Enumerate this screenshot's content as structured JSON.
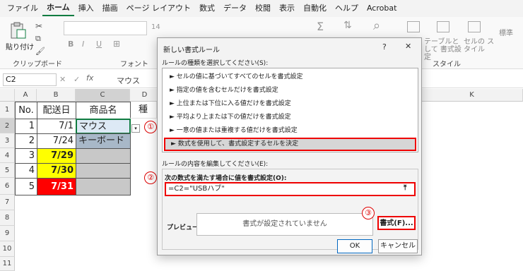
{
  "menu": [
    "ファイル",
    "ホーム",
    "挿入",
    "描画",
    "ページ レイアウト",
    "数式",
    "データ",
    "校閲",
    "表示",
    "自動化",
    "ヘルプ",
    "Acrobat"
  ],
  "ribbon": {
    "paste_label": "貼り付け",
    "clipboard_label": "クリップボード",
    "font_label": "フォント",
    "style_label": "スタイル",
    "font_size": "14",
    "table_format": "テーブルとして 書式設定",
    "cell_style": "セルの スタイル",
    "standard": "標準"
  },
  "formula_bar": {
    "namebox": "C2",
    "fx": "fx",
    "value": "マウス"
  },
  "columns": [
    "A",
    "B",
    "C",
    "D",
    "K"
  ],
  "rows": [
    "1",
    "2",
    "3",
    "4",
    "5",
    "6",
    "7",
    "8",
    "9",
    "10",
    "11"
  ],
  "table": {
    "header": [
      "No.",
      "配送日",
      "商品名",
      "種"
    ],
    "rows": [
      {
        "no": "1",
        "date": "7/1",
        "item": "マウス"
      },
      {
        "no": "2",
        "date": "7/24",
        "item": "キーボード"
      },
      {
        "no": "3",
        "date": "7/29",
        "item": ""
      },
      {
        "no": "4",
        "date": "7/30",
        "item": ""
      },
      {
        "no": "5",
        "date": "7/31",
        "item": ""
      }
    ]
  },
  "markers": [
    "①",
    "②",
    "③"
  ],
  "dialog": {
    "title": "新しい書式ルール",
    "help": "?",
    "close": "✕",
    "rule_type_label": "ルールの種類を選択してください(S):",
    "rules": [
      "► セルの値に基づいてすべてのセルを書式設定",
      "► 指定の値を含むセルだけを書式設定",
      "► 上位または下位に入る値だけを書式設定",
      "► 平均より上または下の値だけを書式設定",
      "► 一意の値または重複する値だけを書式設定",
      "► 数式を使用して、書式設定するセルを決定"
    ],
    "edit_label": "ルールの内容を編集してください(E):",
    "formula_label": "次の数式を満たす場合に値を書式設定(O):",
    "formula_value": "=C2=\"USBハブ\"",
    "preview_label": "プレビュー:",
    "preview_text": "書式が設定されていません",
    "format_button": "書式(F)...",
    "ok_button": "OK",
    "cancel_button": "キャンセル"
  },
  "colors": {
    "accent": "#107c41",
    "highlight_red": "#e00000",
    "yellow": "#ffff00",
    "red_fill": "#ff0000",
    "blue_fill": "#dde9f5",
    "gray_fill": "#c8c8c8"
  }
}
